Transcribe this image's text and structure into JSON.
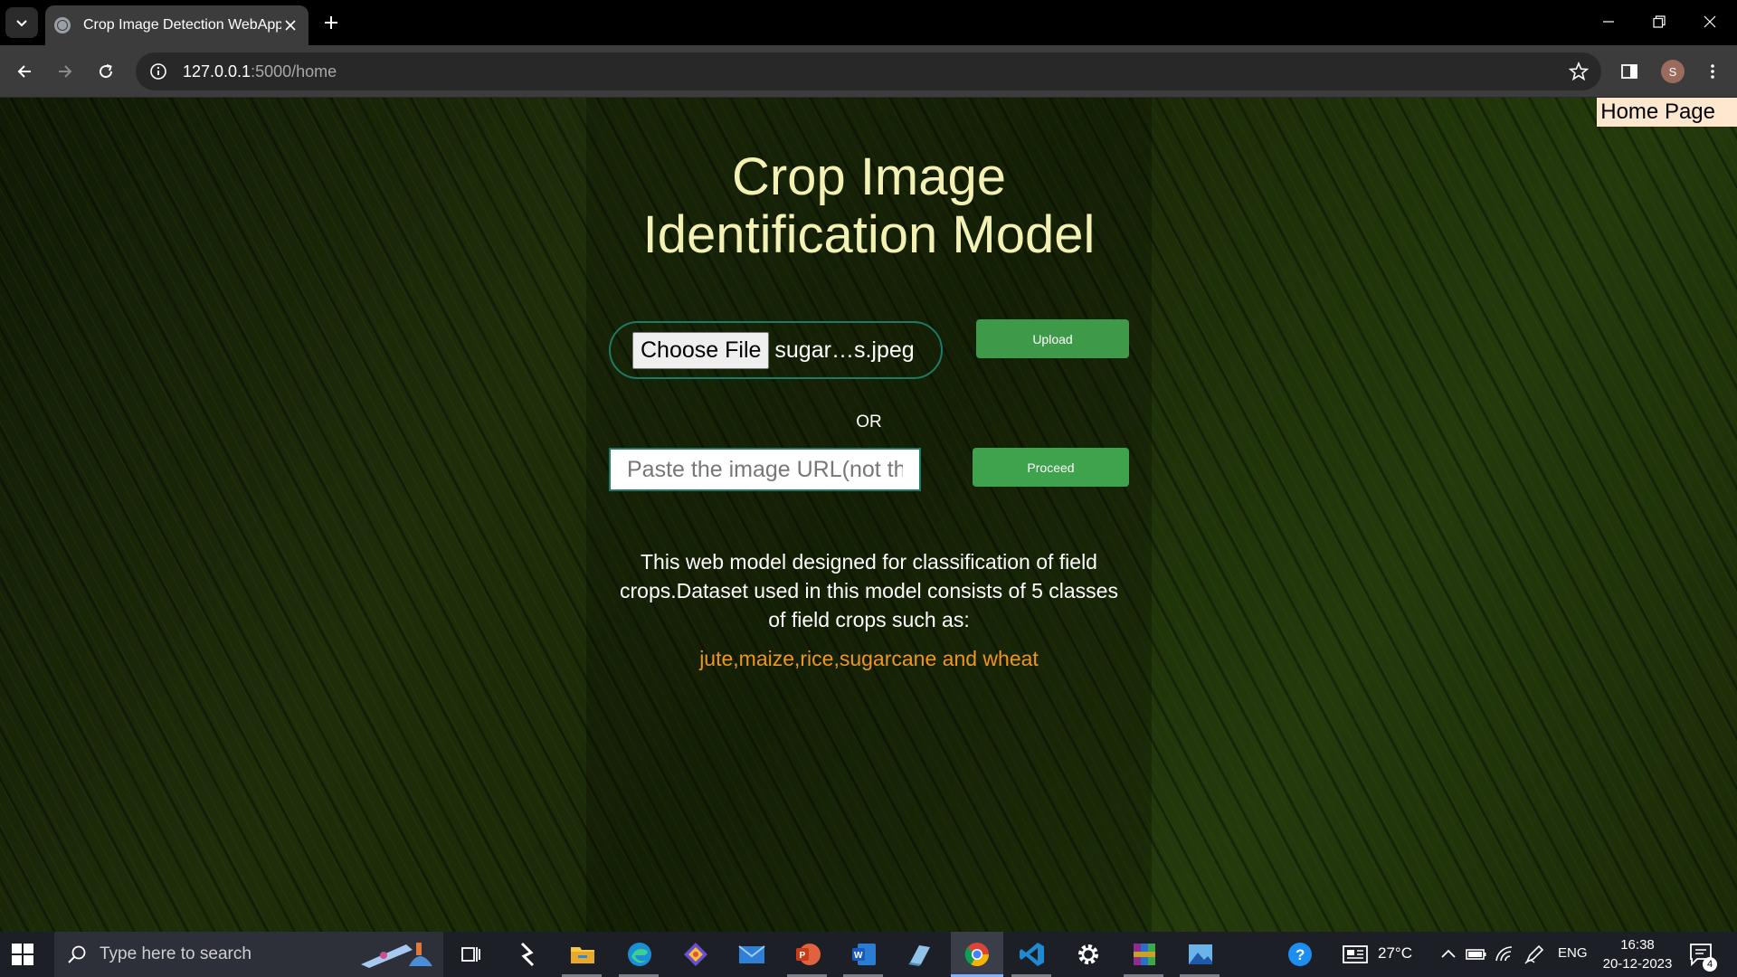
{
  "browser": {
    "tab_title": "Crop Image Detection WebApp",
    "url_host": "127.0.0.1",
    "url_path": ":5000/home",
    "profile_initial": "S"
  },
  "page": {
    "home_link": "Home Page",
    "title": "Crop Image Identification Model",
    "file_input": {
      "button_label": "Choose File",
      "file_name": "sugar…s.jpeg"
    },
    "upload_label": "Upload",
    "or_label": "OR",
    "url_input": {
      "placeholder": "Paste the image URL(not the local path)"
    },
    "proceed_label": "Proceed",
    "description": "This web model designed for classification of field crops.Dataset used in this model consists of 5 classes of field crops such as:",
    "classes": "jute,maize,rice,sugarcane and wheat",
    "colors": {
      "title": "#f4f1b4",
      "classes": "#f0961c",
      "button": "#3e9a48"
    }
  },
  "taskbar": {
    "search_placeholder": "Type here to search",
    "weather": "27°C",
    "language": "ENG",
    "time": "16:38",
    "date": "20-12-2023",
    "notification_count": "4",
    "pinned_icons": [
      "task-view-icon",
      "app-icon",
      "file-explorer-icon",
      "edge-icon",
      "git-icon",
      "mail-icon",
      "powerpoint-icon",
      "word-icon",
      "notes-icon",
      "chrome-icon",
      "vscode-icon",
      "settings-icon",
      "winrar-icon",
      "photos-icon"
    ]
  }
}
